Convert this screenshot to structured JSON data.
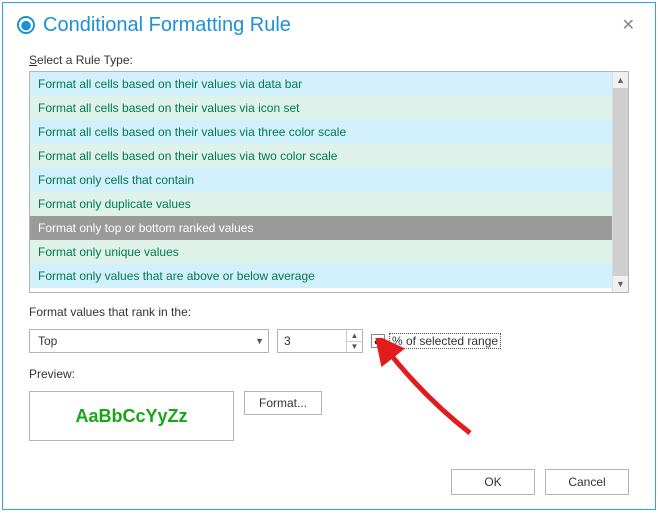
{
  "title": "Conditional Formatting Rule",
  "select_label": "Select a Rule Type:",
  "rule_types": [
    "Format all cells based on their values via data bar",
    "Format all cells based on their values via icon set",
    "Format all cells based on their values via three color scale",
    "Format all cells based on their values via two color scale",
    "Format only cells that contain",
    "Format only duplicate values",
    "Format only top or bottom ranked values",
    "Format only unique values",
    "Format only values that are above or below average"
  ],
  "selected_index": 6,
  "rank_label": "Format values that rank in the:",
  "rank_direction": "Top",
  "rank_value": "3",
  "percent_checked": true,
  "percent_label": "% of selected range",
  "preview_label": "Preview:",
  "preview_sample": "AaBbCcYyZz",
  "format_btn": "Format...",
  "ok_btn": "OK",
  "cancel_btn": "Cancel"
}
